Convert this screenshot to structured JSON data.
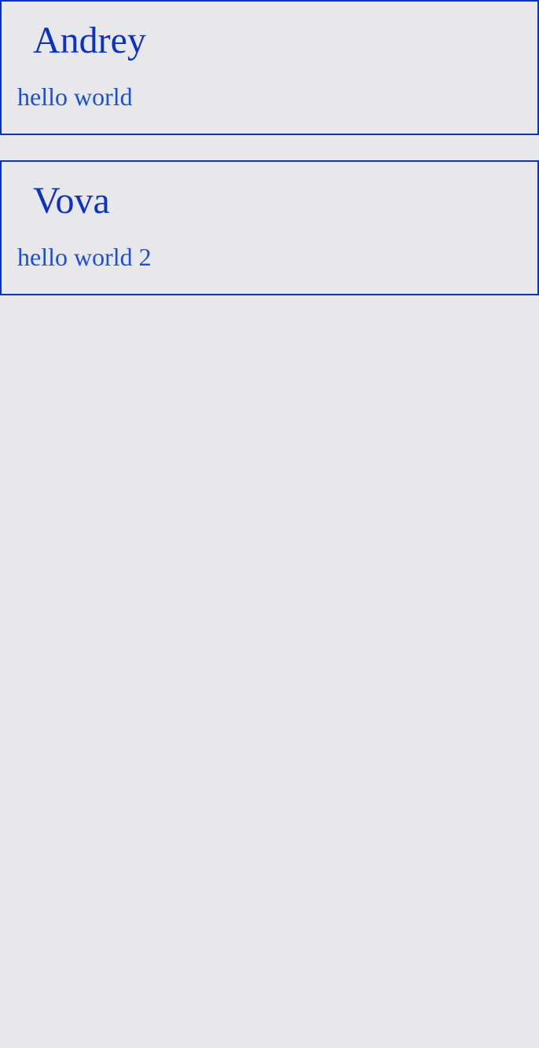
{
  "messages": [
    {
      "author": "Andrey",
      "text": "hello world"
    },
    {
      "author": "Vova",
      "text": "hello world 2"
    }
  ],
  "colors": {
    "background": "#e8e8ea",
    "border": "#0a32c4",
    "author_text": "#0a32c4",
    "message_text": "#1a4fdc"
  }
}
